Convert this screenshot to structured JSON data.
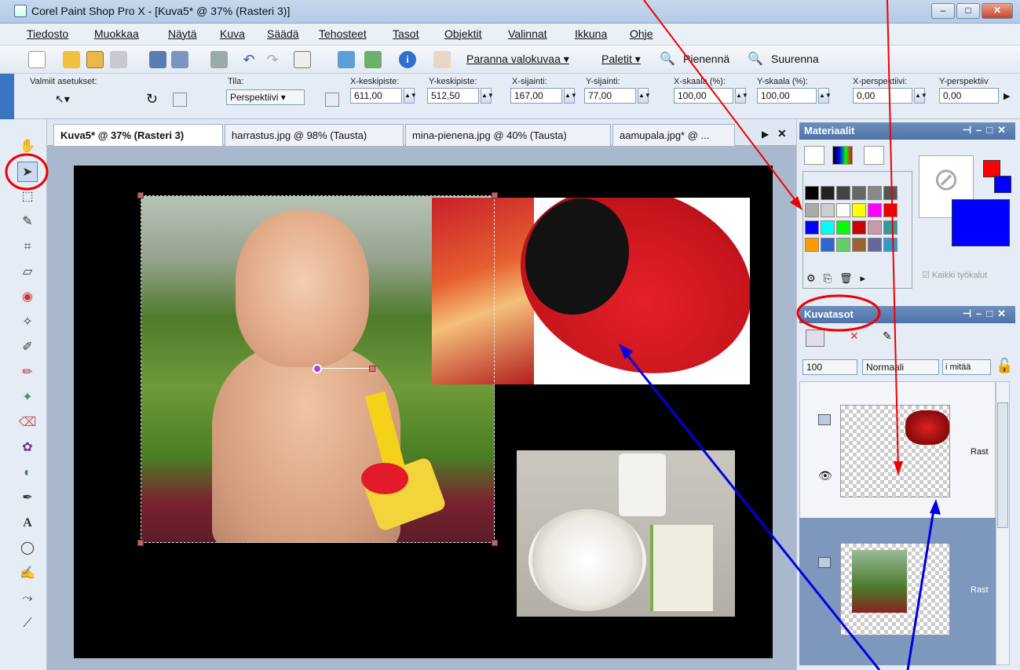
{
  "window": {
    "title": "Corel Paint Shop Pro X - [Kuva5* @ 37% (Rasteri 3)]"
  },
  "menu": [
    "Tiedosto",
    "Muokkaa",
    "Näytä",
    "Kuva",
    "Säädä",
    "Tehosteet",
    "Tasot",
    "Objektit",
    "Valinnat",
    "Ikkuna",
    "Ohje"
  ],
  "toolbar": {
    "enhance": "Paranna valokuvaa ▾",
    "palettes": "Paletit ▾",
    "zoom_out": "Pienennä",
    "zoom_in": "Suurenna"
  },
  "options": {
    "presets_label": "Valmiit asetukset:",
    "mode_label": "Tila:",
    "mode_value": "Perspektiivi",
    "xcenter_label": "X-keskipiste:",
    "xcenter_value": "611,00",
    "ycenter_label": "Y-keskipiste:",
    "ycenter_value": "512,50",
    "xpos_label": "X-sijainti:",
    "xpos_value": "167,00",
    "ypos_label": "Y-sijainti:",
    "ypos_value": "77,00",
    "xscale_label": "X-skaala (%):",
    "xscale_value": "100,00",
    "yscale_label": "Y-skaala (%):",
    "yscale_value": "100,00",
    "xpersp_label": "X-perspektiivi:",
    "xpersp_value": "0,00",
    "ypersp_label": "Y-perspektiiv",
    "ypersp_value": "0,00"
  },
  "tabs": [
    "Kuva5* @ 37% (Rasteri 3)",
    "harrastus.jpg @ 98% (Tausta)",
    "mina-pienena.jpg @ 40% (Tausta)",
    "aamupala.jpg* @ ..."
  ],
  "materials": {
    "title": "Materiaalit",
    "all_tools": "Kaikki työkalut"
  },
  "layers": {
    "title": "Kuvatasot",
    "opacity": "100",
    "blend": "Normaali",
    "mask_label": "i mitää",
    "layer1_name": "Rast",
    "layer2_name": "Rast"
  },
  "colors": {
    "accent": "#4e72a8",
    "foreground": "#ff0000",
    "background": "#0000ff"
  }
}
